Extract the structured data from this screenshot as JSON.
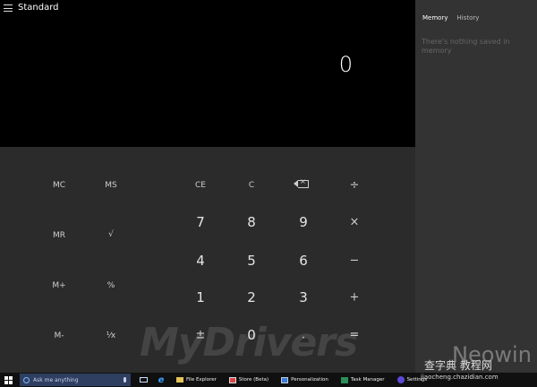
{
  "window": {
    "title": "Standard"
  },
  "display": {
    "value": "0"
  },
  "memory_buttons": [
    "MC",
    "MS",
    "MR",
    "M+",
    "M-"
  ],
  "function_buttons": {
    "sqrt": "√",
    "percent": "%",
    "reciprocal": "¹⁄x",
    "ce": "CE",
    "c": "C"
  },
  "digits": {
    "d7": "7",
    "d8": "8",
    "d9": "9",
    "d4": "4",
    "d5": "5",
    "d6": "6",
    "d1": "1",
    "d2": "2",
    "d3": "3",
    "d0": "0"
  },
  "operators": {
    "divide": "÷",
    "multiply": "×",
    "minus": "−",
    "plus": "+",
    "equals": "=",
    "negate": "±",
    "decimal": "."
  },
  "side_panel": {
    "tabs": [
      {
        "label": "Memory",
        "active": true
      },
      {
        "label": "History",
        "active": false
      }
    ],
    "empty_message": "There's nothing saved in memory"
  },
  "watermarks": {
    "left": "MyDrivers",
    "right": "Neowin",
    "cn": "查字典 教程网",
    "url": "jiaocheng.chazidian.com"
  },
  "taskbar": {
    "search_placeholder": "Ask me anything",
    "apps": [
      "File Explorer",
      "Store (Beta)",
      "Personalization",
      "Task Manager",
      "Settings"
    ]
  },
  "colors": {
    "display_bg": "#000000",
    "keypad_bg": "#2b2b2b",
    "side_bg": "#333333",
    "taskbar_bg": "#101010",
    "search_bg": "#2f3f62"
  }
}
